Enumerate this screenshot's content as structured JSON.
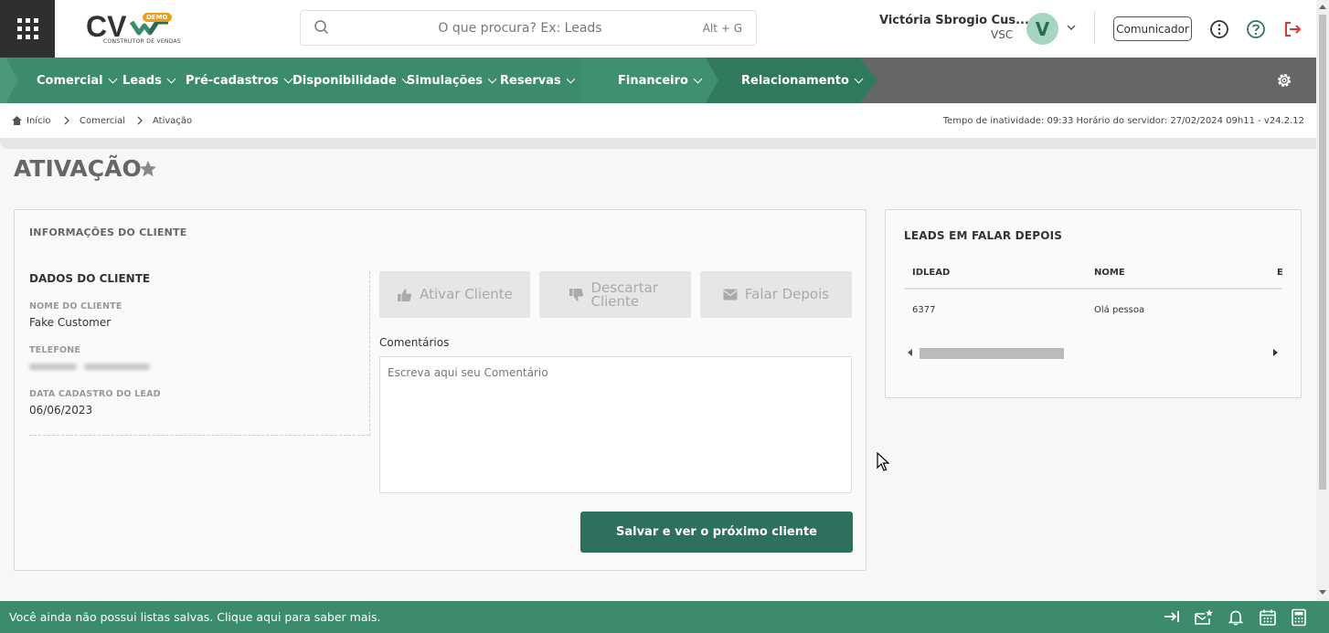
{
  "header": {
    "logo_text": "CV",
    "logo_badge": "DEMO",
    "logo_subtitle": "CONSTRUTOR DE VENDAS",
    "search_placeholder": "O que procura? Ex: Leads",
    "search_shortcut": "Alt + G",
    "user_name": "Victória Sbrogio Cus...",
    "user_org": "VSC",
    "avatar_letter": "V",
    "communicator_label": "Comunicador"
  },
  "nav": {
    "items": [
      {
        "label": "Comercial"
      },
      {
        "label": "Leads"
      },
      {
        "label": "Pré-cadastros"
      },
      {
        "label": "Disponibilidade"
      },
      {
        "label": "Simulações"
      },
      {
        "label": "Reservas"
      },
      {
        "label": "Financeiro"
      },
      {
        "label": "Relacionamento"
      }
    ]
  },
  "breadcrumb": {
    "items": [
      "Início",
      "Comercial",
      "Ativação"
    ],
    "status": "Tempo de inatividade: 09:33   Horário do servidor: 27/02/2024 09h11 - v24.2.12"
  },
  "page": {
    "title": "ATIVAÇÃO"
  },
  "client_card": {
    "title": "INFORMAÇÕES DO CLIENTE",
    "section": "DADOS DO CLIENTE",
    "name_label": "NOME DO CLIENTE",
    "name_value": "Fake Customer",
    "phone_label": "TELEFONE",
    "date_label": "DATA CADASTRO DO LEAD",
    "date_value": "06/06/2023",
    "actions": {
      "activate": "Ativar Cliente",
      "discard": "Descartar Cliente",
      "later": "Falar Depois"
    },
    "comments_label": "Comentários",
    "comments_placeholder": "Escreva aqui seu Comentário",
    "save_label": "Salvar e ver o próximo cliente"
  },
  "leads_card": {
    "title": "LEADS EM FALAR DEPOIS",
    "columns": [
      "IDLEAD",
      "NOME",
      "E"
    ],
    "rows": [
      [
        "6377",
        "Olá pessoa"
      ]
    ]
  },
  "footer": {
    "text": "Você ainda não possui listas salvas. Clique aqui para saber mais."
  },
  "colors": {
    "primary_green": "#3c8c6c",
    "dark_green": "#2f6f5e",
    "nav_gray": "#666666",
    "logout_red": "#d9363e"
  }
}
